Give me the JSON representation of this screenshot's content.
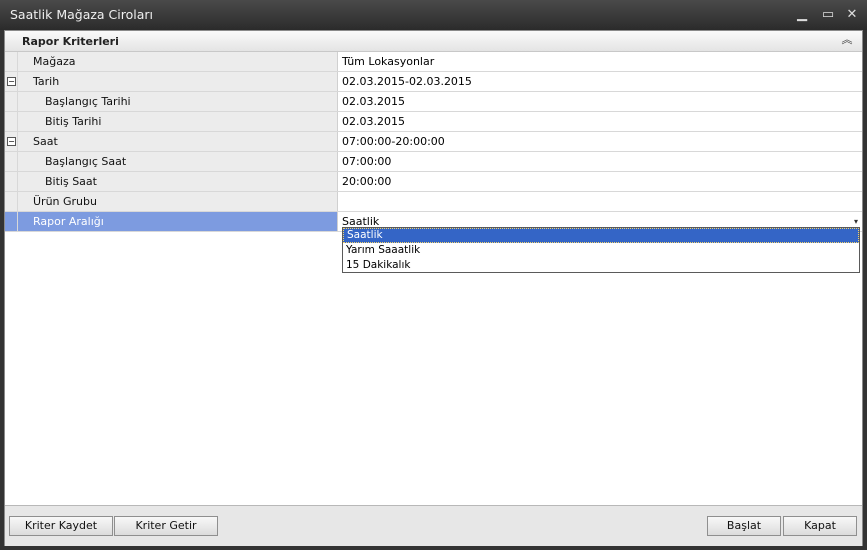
{
  "window": {
    "title": "Saatlik Mağaza Ciroları",
    "minimize": "▁",
    "maximize": "▭",
    "close": "✕"
  },
  "group": {
    "title": "Rapor Kriterleri",
    "collapse": "︽"
  },
  "rows": [
    {
      "label": "Mağaza",
      "value": "Tüm Lokasyonlar"
    },
    {
      "label": "Tarih",
      "value": "02.03.2015-02.03.2015",
      "expander": "−"
    },
    {
      "label": "Başlangıç Tarihi",
      "value": "02.03.2015"
    },
    {
      "label": "Bitiş Tarihi",
      "value": "02.03.2015"
    },
    {
      "label": "Saat",
      "value": "07:00:00-20:00:00",
      "expander": "−"
    },
    {
      "label": "Başlangıç Saat",
      "value": "07:00:00"
    },
    {
      "label": "Bitiş Saat",
      "value": "20:00:00"
    },
    {
      "label": "Ürün Grubu",
      "value": ""
    },
    {
      "label": "Rapor Aralığı",
      "value": "Saatlik",
      "arrow": "▾"
    }
  ],
  "dropdown": {
    "options": [
      "Saatlik",
      "Yarım Saaatlik",
      "15 Dakikalık"
    ],
    "selected": "Saatlik"
  },
  "buttons": {
    "save_criteria": "Kriter Kaydet",
    "load_criteria": "Kriter Getir",
    "start": "Başlat",
    "close": "Kapat"
  },
  "colors": {
    "selected_row": "#7d9be0",
    "dropdown_highlight": "#3465c6"
  }
}
